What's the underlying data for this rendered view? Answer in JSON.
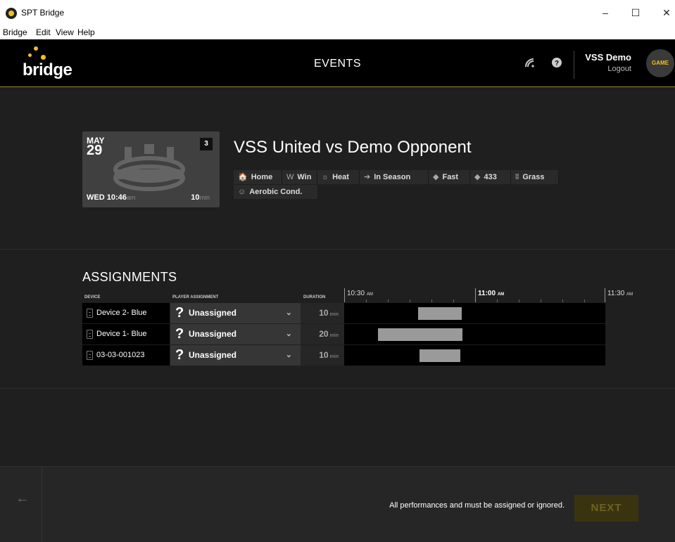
{
  "window": {
    "title": "SPT Bridge",
    "minimize": "–",
    "maximize": "☐",
    "close": "✕"
  },
  "menu": [
    "Bridge",
    "Edit",
    "View",
    "Help"
  ],
  "header": {
    "logo": "bridge",
    "title": "EVENTS",
    "sync_icon": "wireless-icon",
    "help_icon": "help-icon",
    "user_name": "VSS Demo",
    "logout": "Logout",
    "avatar_text": "GAME"
  },
  "event": {
    "month": "MAY",
    "day": "29",
    "count": "3",
    "weekday_time": "WED 10:46",
    "ampm": "am",
    "duration": "10",
    "duration_unit": "min",
    "title": "VSS United vs Demo Opponent",
    "tags": [
      {
        "icon": "home-icon",
        "glyph": "🏠",
        "label": "Home"
      },
      {
        "icon": "win-icon",
        "glyph": "W",
        "label": "Win"
      },
      {
        "icon": "sun-icon",
        "glyph": "☼",
        "label": "Heat"
      },
      {
        "icon": "season-icon",
        "glyph": "➔",
        "label": "In Season"
      },
      {
        "icon": "tag-icon",
        "glyph": "◆",
        "label": "Fast"
      },
      {
        "icon": "tag-icon",
        "glyph": "◆",
        "label": "433"
      },
      {
        "icon": "grass-icon",
        "glyph": "ʬ",
        "label": "Grass"
      },
      {
        "icon": "user-icon",
        "glyph": "☺",
        "label": "Aerobic Cond."
      }
    ]
  },
  "assignments": {
    "title": "ASSIGNMENTS",
    "columns": {
      "device": "DEVICE",
      "player": "PLAYER ASSIGNMENT",
      "duration": "DURATION"
    },
    "timeline_labels": [
      {
        "time": "10:30",
        "suffix": "AM"
      },
      {
        "time": "11:00",
        "suffix": "AM"
      },
      {
        "time": "11:30",
        "suffix": "AM"
      }
    ],
    "rows": [
      {
        "device": "Device 2- Blue",
        "player": "Unassigned",
        "duration": "10",
        "unit": "min"
      },
      {
        "device": "Device 1- Blue",
        "player": "Unassigned",
        "duration": "20",
        "unit": "min"
      },
      {
        "device": "03-03-001023",
        "player": "Unassigned",
        "duration": "10",
        "unit": "min"
      }
    ]
  },
  "footer": {
    "message": "All performances and must be assigned or ignored.",
    "next": "NEXT"
  },
  "colors": {
    "accent": "#f0c020",
    "background": "#1f1f1f",
    "header": "#000000",
    "next_disabled": "#3a3310"
  }
}
